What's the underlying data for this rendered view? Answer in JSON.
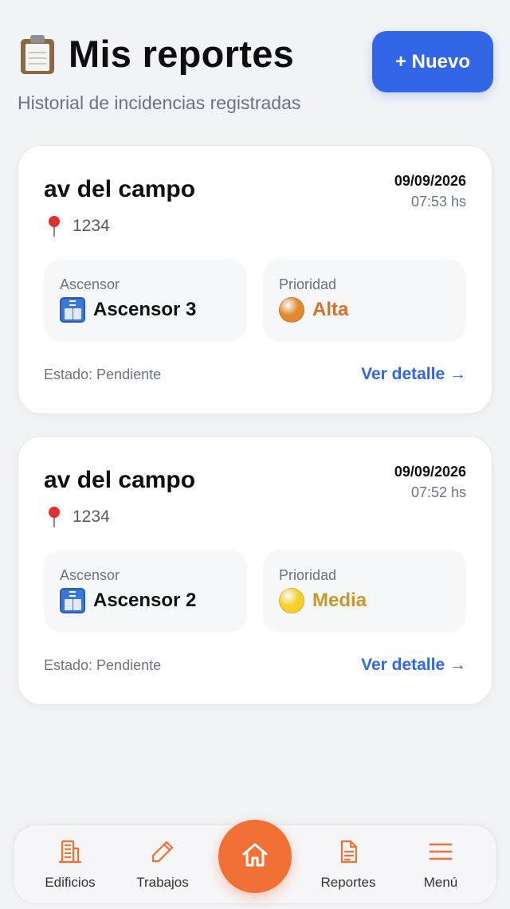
{
  "header": {
    "title": "Mis reportes",
    "title_icon": "clipboard-icon",
    "subtitle": "Historial de incidencias registradas",
    "new_button": "+ Nuevo"
  },
  "reports": [
    {
      "title": "av del campo",
      "date": "09/09/2026",
      "time": "07:53 hs",
      "address": "1234",
      "elevator_label": "Ascensor",
      "elevator_value": "Ascensor 3",
      "priority_label": "Prioridad",
      "priority_value": "Alta",
      "priority_color": "#d9702a",
      "priority_dot_color": "#e08a2c",
      "status": "Estado: Pendiente",
      "link": "Ver detalle →"
    },
    {
      "title": "av del campo",
      "date": "09/09/2026",
      "time": "07:52 hs",
      "address": "1234",
      "elevator_label": "Ascensor",
      "elevator_value": "Ascensor 2",
      "priority_label": "Prioridad",
      "priority_value": "Media",
      "priority_color": "#c69a2a",
      "priority_dot_color": "#f5cf2a",
      "status": "Estado: Pendiente",
      "link": "Ver detalle →"
    }
  ],
  "nav": {
    "accent": "#f07036",
    "items": [
      {
        "label": "Edificios",
        "icon": "building-icon"
      },
      {
        "label": "Trabajos",
        "icon": "pencil-icon"
      },
      {
        "label": "",
        "icon": "home-icon"
      },
      {
        "label": "Reportes",
        "icon": "document-icon"
      },
      {
        "label": "Menú",
        "icon": "menu-icon"
      }
    ]
  },
  "colors": {
    "primary": "#3366e6",
    "background": "#f2f3f6"
  }
}
